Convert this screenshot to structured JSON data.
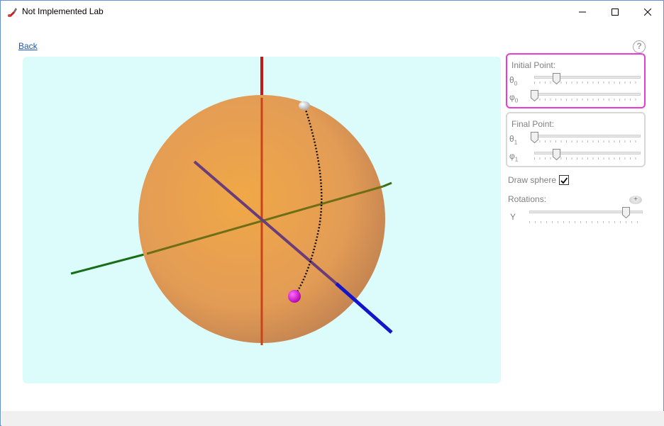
{
  "window": {
    "title": "Not Implemented Lab",
    "app_icon": "pen-dropper-icon",
    "controls": [
      "minimize-icon",
      "maximize-icon",
      "close-icon"
    ]
  },
  "nav": {
    "back_label": "Back",
    "help_label": "?"
  },
  "scene": {
    "background": "#dcfcfc",
    "sphere_color": "#e8a04c",
    "axes": {
      "x_color": "#1a1acc",
      "y_color": "#1a6e1a",
      "z_color": "#cc1a1a"
    },
    "start_point_color": "#e0e0e0",
    "end_point_color": "#e020e0"
  },
  "initial_point": {
    "title": "Initial Point:",
    "theta_symbol": "θ",
    "theta_sub": "0",
    "phi_symbol": "φ",
    "phi_sub": "0",
    "theta_value": 0.2,
    "phi_value": 0.0,
    "border_color": "#e83bd8"
  },
  "final_point": {
    "title": "Final Point:",
    "theta_symbol": "θ",
    "theta_sub": "1",
    "phi_symbol": "φ",
    "phi_sub": "1",
    "theta_value": 0.0,
    "phi_value": 0.2
  },
  "options": {
    "draw_sphere_label": "Draw sphere",
    "draw_sphere_checked": true
  },
  "rotations": {
    "label": "Rotations:",
    "add_label": "+",
    "axis_label": "Y",
    "value": 0.85
  }
}
